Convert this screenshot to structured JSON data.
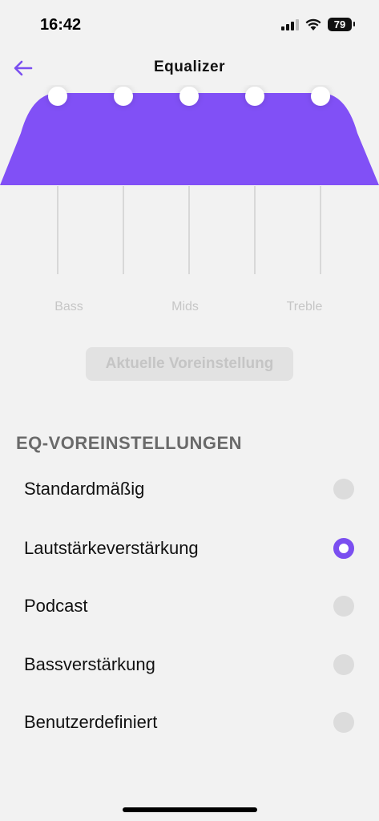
{
  "status": {
    "time": "16:42",
    "battery": "79"
  },
  "header": {
    "title": "Equalizer"
  },
  "eq": {
    "labels": [
      "Bass",
      "Mids",
      "Treble"
    ],
    "fill_color": "#8150f6"
  },
  "current_preset_button": "Aktuelle Voreinstellung",
  "section_title": "EQ-VOREINSTELLUNGEN",
  "presets": [
    {
      "label": "Standardmäßig",
      "selected": false
    },
    {
      "label": "Lautstärkeverstärkung",
      "selected": true
    },
    {
      "label": "Podcast",
      "selected": false
    },
    {
      "label": "Bassverstärkung",
      "selected": false
    },
    {
      "label": "Benutzerdefiniert",
      "selected": false
    }
  ],
  "colors": {
    "accent": "#7b4ff0",
    "background": "#f2f2f2"
  }
}
